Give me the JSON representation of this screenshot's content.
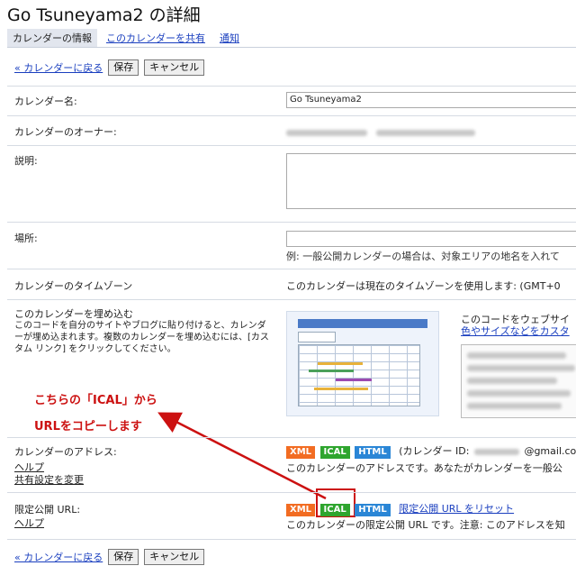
{
  "header": {
    "title": "Go Tsuneyama2 の詳細",
    "tabs": [
      {
        "label": "カレンダーの情報"
      },
      {
        "label": "このカレンダーを共有"
      },
      {
        "label": "通知"
      }
    ]
  },
  "actions": {
    "back_label": "« カレンダーに戻る",
    "save_label": "保存",
    "cancel_label": "キャンセル"
  },
  "fields": {
    "name_label": "カレンダー名:",
    "name_value": "Go Tsuneyama2",
    "owner_label": "カレンダーのオーナー:",
    "description_label": "説明:",
    "location_label": "場所:",
    "location_hint": "例: 一般公開カレンダーの場合は、対象エリアの地名を入れて",
    "timezone_label": "カレンダーのタイムゾーン",
    "timezone_value": "このカレンダーは現在のタイムゾーンを使用します: (GMT+0",
    "embed_label": "このカレンダーを埋め込む",
    "embed_desc": "このコードを自分のサイトやブログに貼り付けると、カレンダーが埋め込まれます。複数のカレンダーを埋め込むには、[カスタム リンク] をクリックしてください。",
    "embed_hint_1": "このコードをウェブサイ",
    "embed_hint_link": "色やサイズなどをカスタ",
    "address_label": "カレンダーのアドレス:",
    "address_help": "ヘルプ",
    "address_share_link": "共有設定を変更",
    "address_id_prefix": "(カレンダー ID:",
    "address_id_suffix": "@gmail.com)",
    "address_desc": "このカレンダーのアドレスです。あなたがカレンダーを一般公",
    "private_label": "限定公開 URL:",
    "private_help": "ヘルプ",
    "private_reset_link": "限定公開 URL をリセット",
    "private_desc": "このカレンダーの限定公開 URL です。注意: このアドレスを知"
  },
  "badges": {
    "xml": "XML",
    "ical": "ICAL",
    "html": "HTML"
  },
  "annotation": {
    "line1": "こちらの「ICAL」から",
    "line2": "URLをコピーします",
    "color": "#cc1111"
  }
}
